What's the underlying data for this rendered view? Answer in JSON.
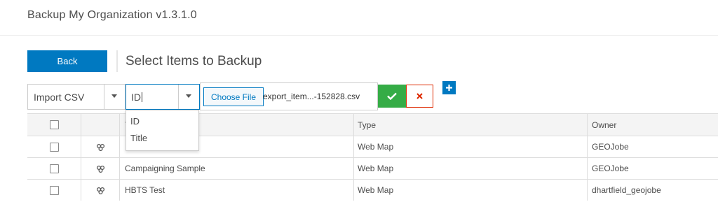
{
  "app": {
    "title": "Backup My Organization v1.3.1.0"
  },
  "toolbar": {
    "back_label": "Back",
    "page_title": "Select Items to Backup",
    "import_select": "Import CSV",
    "field_select": "ID",
    "choose_file_label": "Choose File",
    "file_name": "export_item...-152828.csv",
    "ok_icon": "check-icon",
    "cancel_icon": "close-icon",
    "add_icon": "plus-icon"
  },
  "dropdown": {
    "options": [
      "ID",
      "Title"
    ]
  },
  "table": {
    "headers": {
      "title": "T",
      "type": "Type",
      "owner": "Owner"
    },
    "rows": [
      {
        "title": "",
        "type": "Web Map",
        "owner": "GEOJobe",
        "icon": "web-map-icon"
      },
      {
        "title": "Campaigning Sample",
        "type": "Web Map",
        "owner": "GEOJobe",
        "icon": "web-map-icon"
      },
      {
        "title": "HBTS Test",
        "type": "Web Map",
        "owner": "dhartfield_geojobe",
        "icon": "web-map-icon"
      }
    ]
  },
  "colors": {
    "accent": "#0079c1",
    "ok": "#35ac46",
    "cancel": "#de2900"
  }
}
